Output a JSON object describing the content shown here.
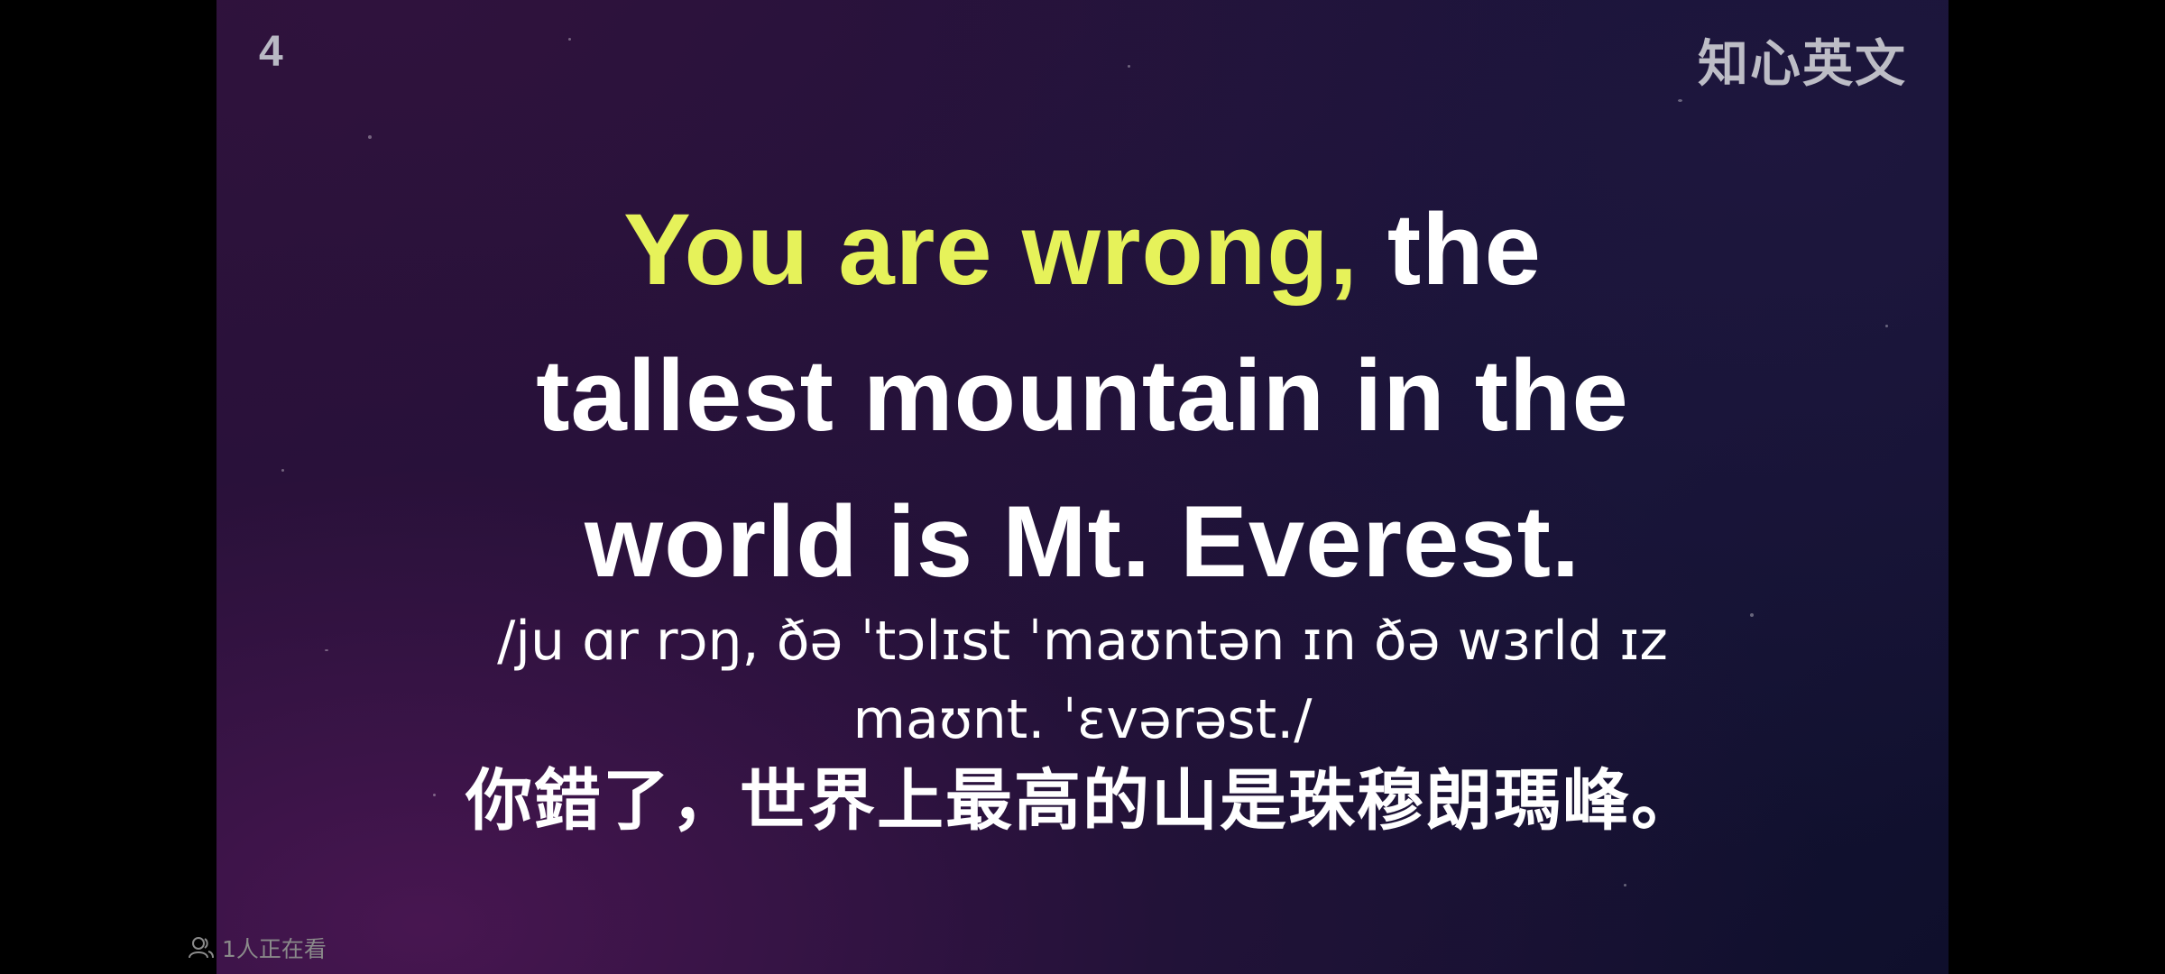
{
  "video": {
    "slide_number": "4",
    "brand": "知心英文",
    "english": {
      "highlight": "You are wrong,",
      "line1_rest": " the",
      "line2": "tallest mountain in the",
      "line3": "world is Mt. Everest."
    },
    "ipa": {
      "line1": "/ju ɑr rɔŋ, ðə ˈtɔlɪst ˈmaʊntən ɪn ðə wɜrld ɪz",
      "line2": "maʊnt. ˈɛvərəst./"
    },
    "chinese": "你錯了，世界上最高的山是珠穆朗瑪峰。"
  },
  "overlay": {
    "viewers_icon": "people-icon",
    "viewers_text": "1人正在看"
  },
  "colors": {
    "highlight": "#e6f25a",
    "text": "#ffffff",
    "background": "#000000"
  }
}
